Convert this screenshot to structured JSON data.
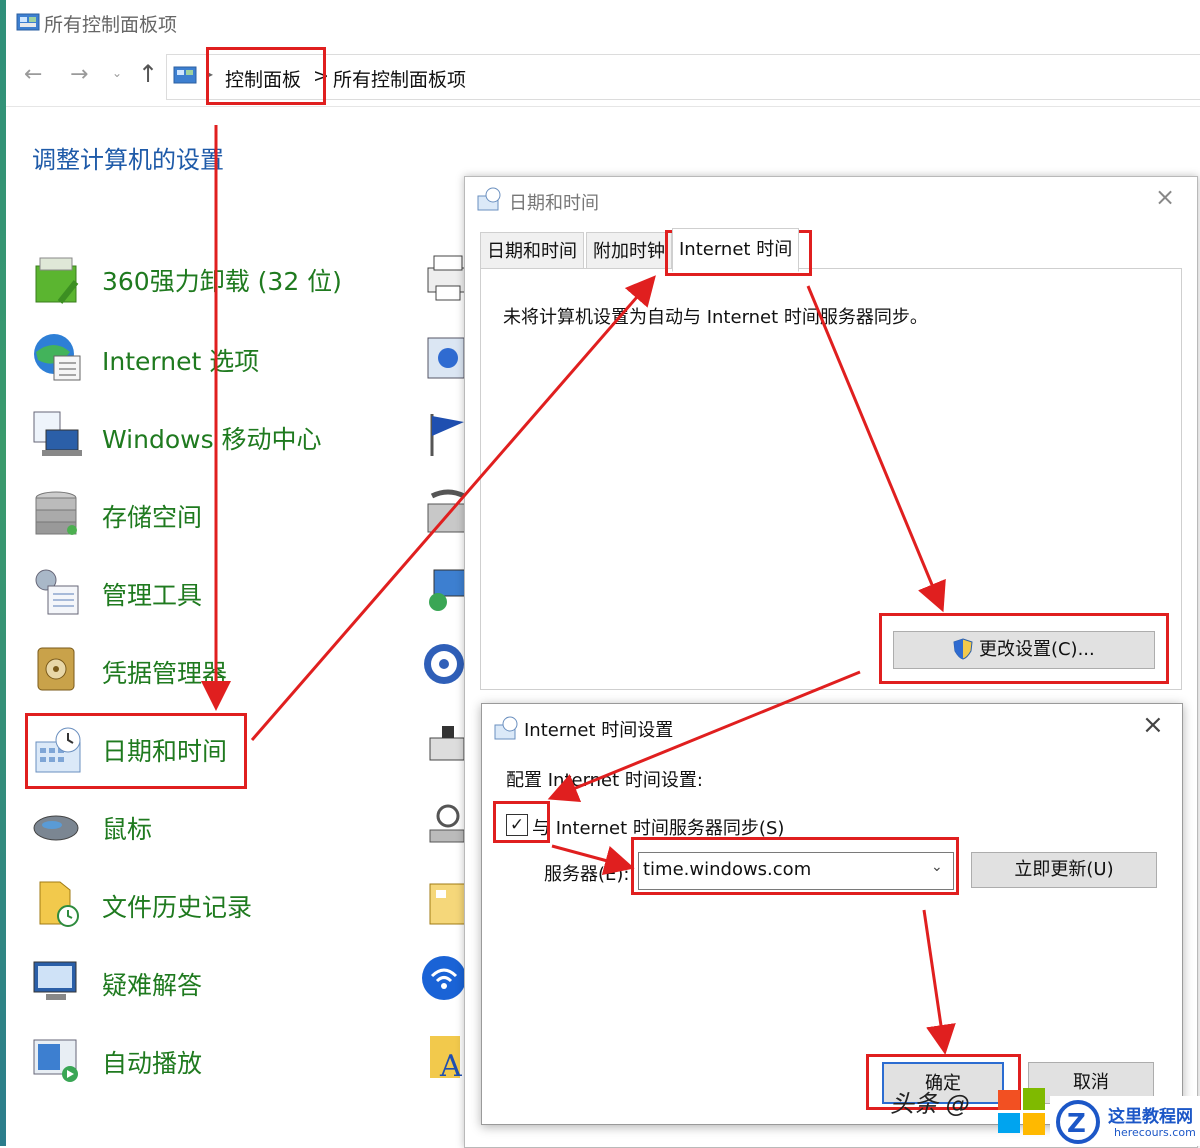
{
  "window": {
    "title": "所有控制面板项"
  },
  "address": {
    "crumb1": "控制面板",
    "crumb2": "所有控制面板项",
    "separator": ">"
  },
  "heading": "调整计算机的设置",
  "items": [
    {
      "label": "360强力卸载 (32 位)",
      "icon": "uninstaller-icon"
    },
    {
      "label": "Internet 选项",
      "icon": "globe-icon"
    },
    {
      "label": "Windows 移动中心",
      "icon": "mobility-center-icon"
    },
    {
      "label": "存储空间",
      "icon": "storage-icon"
    },
    {
      "label": "管理工具",
      "icon": "admin-tools-icon"
    },
    {
      "label": "凭据管理器",
      "icon": "credential-vault-icon"
    },
    {
      "label": "日期和时间",
      "icon": "date-time-icon"
    },
    {
      "label": "鼠标",
      "icon": "mouse-icon"
    },
    {
      "label": "文件历史记录",
      "icon": "file-history-icon"
    },
    {
      "label": "疑难解答",
      "icon": "troubleshoot-icon"
    },
    {
      "label": "自动播放",
      "icon": "autoplay-icon"
    }
  ],
  "dialog": {
    "title": "日期和时间",
    "tabs": [
      "日期和时间",
      "附加时钟",
      "Internet 时间"
    ],
    "message": "未将计算机设置为自动与 Internet 时间服务器同步。",
    "change_button": "更改设置(C)..."
  },
  "subdialog": {
    "title": "Internet 时间设置",
    "config_label": "配置 Internet 时间设置:",
    "sync_checkbox_label": "与 Internet 时间服务器同步(S)",
    "sync_checked": true,
    "server_label": "服务器(E):",
    "server_value": "time.windows.com",
    "update_button": "立即更新(U)",
    "ok_button": "确定",
    "cancel_button": "取消"
  },
  "watermark": {
    "text": "头条 @",
    "brand": "这里教程网",
    "url": "herecours.com"
  },
  "colors": {
    "accent_red": "#e01f1f",
    "item_green": "#1f7a1f",
    "heading_blue": "#1e5aa8"
  }
}
